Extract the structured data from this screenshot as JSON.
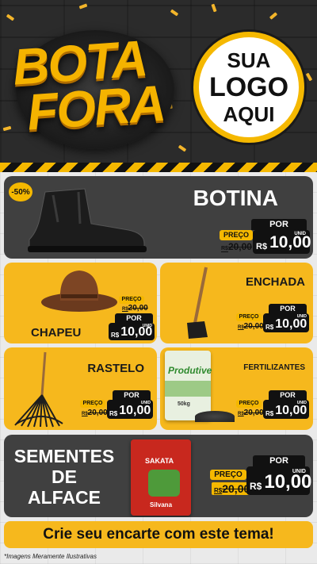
{
  "header": {
    "title_line1": "BOTA",
    "title_line2": "FORA",
    "logo_line1": "SUA",
    "logo_line2": "LOGO",
    "logo_line3": "AQUI"
  },
  "products": [
    {
      "name": "BOTINA",
      "badge": "-50%",
      "por": "POR",
      "preco": "PREÇO",
      "old_price": "20,00",
      "old_prefix": "R$",
      "currency": "R$",
      "price": "10,00",
      "unid": "UNID"
    },
    {
      "name": "CHAPEU",
      "por": "POR",
      "preco": "PREÇO",
      "old_price": "20,00",
      "old_prefix": "R$",
      "currency": "R$",
      "price": "10,00",
      "unid": "UNID"
    },
    {
      "name": "ENCHADA",
      "por": "POR",
      "preco": "PREÇO",
      "old_price": "20,00",
      "old_prefix": "R$",
      "currency": "R$",
      "price": "10,00",
      "unid": "UNID"
    },
    {
      "name": "RASTELO",
      "por": "POR",
      "preco": "PREÇO",
      "old_price": "20,00",
      "old_prefix": "R$",
      "currency": "R$",
      "price": "10,00",
      "unid": "UNID"
    },
    {
      "name": "FERTILIZANTES",
      "product_label": "Produtive",
      "product_weight": "50kg",
      "por": "POR",
      "preco": "PREÇO",
      "old_price": "20,00",
      "old_prefix": "R$",
      "currency": "R$",
      "price": "10,00",
      "unid": "UNID"
    },
    {
      "name_line1": "SEMENTES",
      "name_line2": "DE",
      "name_line3": "ALFACE",
      "package_brand": "SAKATA",
      "package_label": "Silvana",
      "por": "POR",
      "preco": "PREÇO",
      "old_price": "20,00",
      "old_prefix": "R$",
      "currency": "R$",
      "price": "10,00",
      "unid": "UNID"
    }
  ],
  "cta": "Crie seu encarte com este tema!",
  "footnote": "*Imagens Meramente Ilustrativas",
  "colors": {
    "accent": "#f6b81d",
    "dark": "#404040",
    "black": "#111111"
  }
}
